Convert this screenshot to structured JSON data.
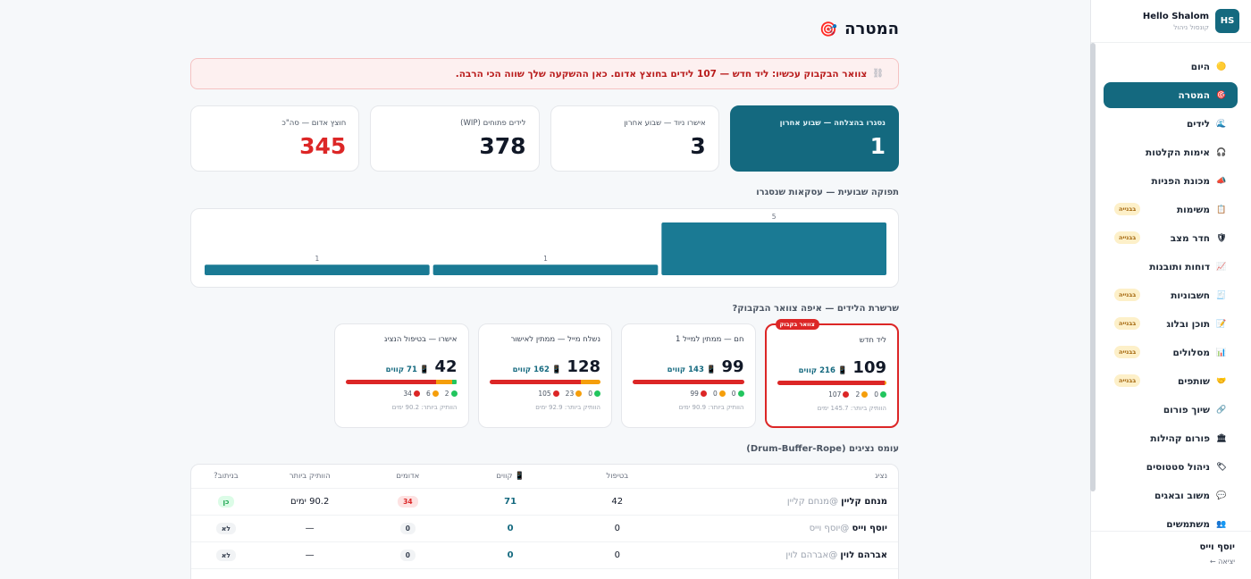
{
  "sidebar": {
    "greeting": "Hello Shalom",
    "role": "קונסול ניהול",
    "avatar": "HS",
    "items": [
      {
        "label": "היום",
        "icon": "sun-icon",
        "glyph": "🟡"
      },
      {
        "label": "המטרה",
        "icon": "target-icon",
        "glyph": "🎯",
        "active": true
      },
      {
        "label": "לידים",
        "icon": "wave-icon",
        "glyph": "🌊"
      },
      {
        "label": "אימות הקלטות",
        "icon": "headphones-icon",
        "glyph": "🎧"
      },
      {
        "label": "מכונת הפניות",
        "icon": "megaphone-icon",
        "glyph": "📣"
      },
      {
        "label": "משימות",
        "icon": "clipboard-icon",
        "glyph": "📋",
        "badge": "בבנייה"
      },
      {
        "label": "חדר מצב",
        "icon": "shield-icon",
        "glyph": "🛡",
        "badge": "בבנייה"
      },
      {
        "label": "דוחות ותובנות",
        "icon": "chart-up-icon",
        "glyph": "📈"
      },
      {
        "label": "חשבוניות",
        "icon": "receipt-icon",
        "glyph": "🧾",
        "badge": "בבנייה"
      },
      {
        "label": "תוכן ובלוג",
        "icon": "pencil-icon",
        "glyph": "📝",
        "badge": "בבנייה"
      },
      {
        "label": "מסלולים",
        "icon": "bar-chart-icon",
        "glyph": "📊",
        "badge": "בבנייה"
      },
      {
        "label": "שותפים",
        "icon": "handshake-icon",
        "glyph": "🤝",
        "badge": "בבנייה"
      },
      {
        "label": "שיוך פורום",
        "icon": "link-icon",
        "glyph": "🔗"
      },
      {
        "label": "פורום קהילות",
        "icon": "building-icon",
        "glyph": "🏛"
      },
      {
        "label": "ניהול סטטוסים",
        "icon": "tag-icon",
        "glyph": "🏷"
      },
      {
        "label": "משוב ובאגים",
        "icon": "speech-bubble-icon",
        "glyph": "💬"
      },
      {
        "label": "משתמשים",
        "icon": "users-icon",
        "glyph": "👥"
      }
    ],
    "footer": {
      "name": "יוסף וייס",
      "logout": "יציאה ←"
    }
  },
  "page": {
    "title": "המטרה",
    "title_icon": "🎯"
  },
  "alert": {
    "icon": "⛓",
    "text": "צוואר הבקבוק עכשיו: ליד חדש — 107 לידים בחוצץ אדום. כאן ההשקעה שלך שווה הכי הרבה."
  },
  "kpis": [
    {
      "label": "נסגרו בהצלחה — שבוע אחרון",
      "value": "1",
      "style": "dark"
    },
    {
      "label": "אישרו ניוד — שבוע אחרון",
      "value": "3",
      "style": "normal"
    },
    {
      "label": "לידים פתוחים (WIP)",
      "value": "378",
      "style": "normal"
    },
    {
      "label": "חוצץ אדום — סה\"כ",
      "value": "345",
      "style": "red"
    }
  ],
  "throughput": {
    "title": "תפוקה שבועית — עסקאות שנסגרו"
  },
  "chart_data": {
    "type": "bar",
    "categories": [
      "",
      "",
      ""
    ],
    "values": [
      1,
      1,
      5
    ],
    "title": "תפוקה שבועית — עסקאות שנסגרו",
    "color": "#1a7a94"
  },
  "pipeline": {
    "title": "שרשרת הלידים — איפה צוואר הבקבוק?",
    "bottleneck_label": "צוואר בקבוק",
    "stages": [
      {
        "name": "ליד חדש",
        "count": "109",
        "calls": "216 קווים",
        "green": 0,
        "yellow": 2,
        "red": 107,
        "oldest": "הוותיק ביותר: 145.7 ימים",
        "bottleneck": true
      },
      {
        "name": "חם — ממתין למייל 1",
        "count": "99",
        "calls": "143 קווים",
        "green": 0,
        "yellow": 0,
        "red": 99,
        "oldest": "הוותיק ביותר: 90.9 ימים",
        "bottleneck": false
      },
      {
        "name": "נשלח מייל — ממתין לאישור",
        "count": "128",
        "calls": "162 קווים",
        "green": 0,
        "yellow": 23,
        "red": 105,
        "oldest": "הוותיק ביותר: 92.9 ימים",
        "bottleneck": false
      },
      {
        "name": "אישרו — בטיפול הנציג",
        "count": "42",
        "calls": "71 קווים",
        "green": 2,
        "yellow": 6,
        "red": 34,
        "oldest": "הוותיק ביותר: 90.2 ימים",
        "bottleneck": false
      }
    ]
  },
  "agents": {
    "title": "עומס נציגים (Drum-Buffer-Rope)",
    "columns": [
      "נציג",
      "בטיפול",
      "קווים",
      "אדומים",
      "הוותיק ביותר",
      "בניתוב?"
    ],
    "rows": [
      {
        "name": "מנחם קליין",
        "handle": "@מנחם קליין",
        "in_care": "42",
        "calls": "71",
        "reds": "34",
        "oldest": "90.2 ימים",
        "routing": "כן"
      },
      {
        "name": "יוסף וייס",
        "handle": "@יוסף וייס",
        "in_care": "0",
        "calls": "0",
        "reds": "0",
        "oldest": "—",
        "routing": "לא"
      },
      {
        "name": "אברהם לוין",
        "handle": "@אברהם לוין",
        "in_care": "0",
        "calls": "0",
        "reds": "0",
        "oldest": "—",
        "routing": "לא"
      }
    ]
  },
  "colors": {
    "teal": "#14697f",
    "red": "#dc2626",
    "yellow": "#f59e0b",
    "green": "#22c55e"
  }
}
